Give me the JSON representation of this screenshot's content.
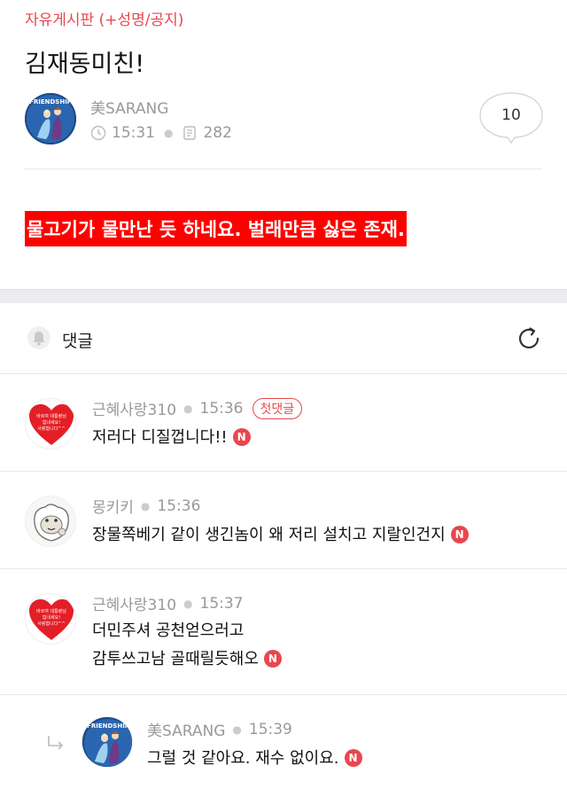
{
  "post": {
    "board": "자유게시판 (+성명/공지)",
    "title": "김재동미친!",
    "author": "美SARANG",
    "time": "15:31",
    "views": "282",
    "comment_count": "10",
    "content": "물고기가 물만난 듯 하네요. 벌래만큼 싫은 존재.",
    "avatar_text": "FRIENDSHIP"
  },
  "comments_header": {
    "label": "댓글"
  },
  "comments": [
    {
      "author": "근혜사랑310",
      "time": "15:36",
      "badge": "첫댓글",
      "lines": [
        "저러다 디질껍니다!!"
      ],
      "avatar_lines": [
        "바르여 대통령님",
        "힘내세요!",
        "사랑합니다^^"
      ]
    },
    {
      "author": "몽키키",
      "time": "15:36",
      "lines": [
        "장물쪽베기 같이 생긴놈이 왜 저리 설치고 지랄인건지"
      ]
    },
    {
      "author": "근혜사랑310",
      "time": "15:37",
      "lines": [
        "더민주셔 공천얻으러고",
        "감투쓰고남 골때릴듯해오"
      ],
      "avatar_lines": [
        "바르여 대통령님",
        "힘내세요!",
        "사랑합니다^^"
      ]
    },
    {
      "author": "美SARANG",
      "time": "15:39",
      "lines": [
        "그럴 것 같아요. 재수 없이요."
      ]
    }
  ],
  "new_badge": "N",
  "colors": {
    "accent": "#e8474d",
    "highlight": "#ff0000",
    "muted": "#999999"
  }
}
